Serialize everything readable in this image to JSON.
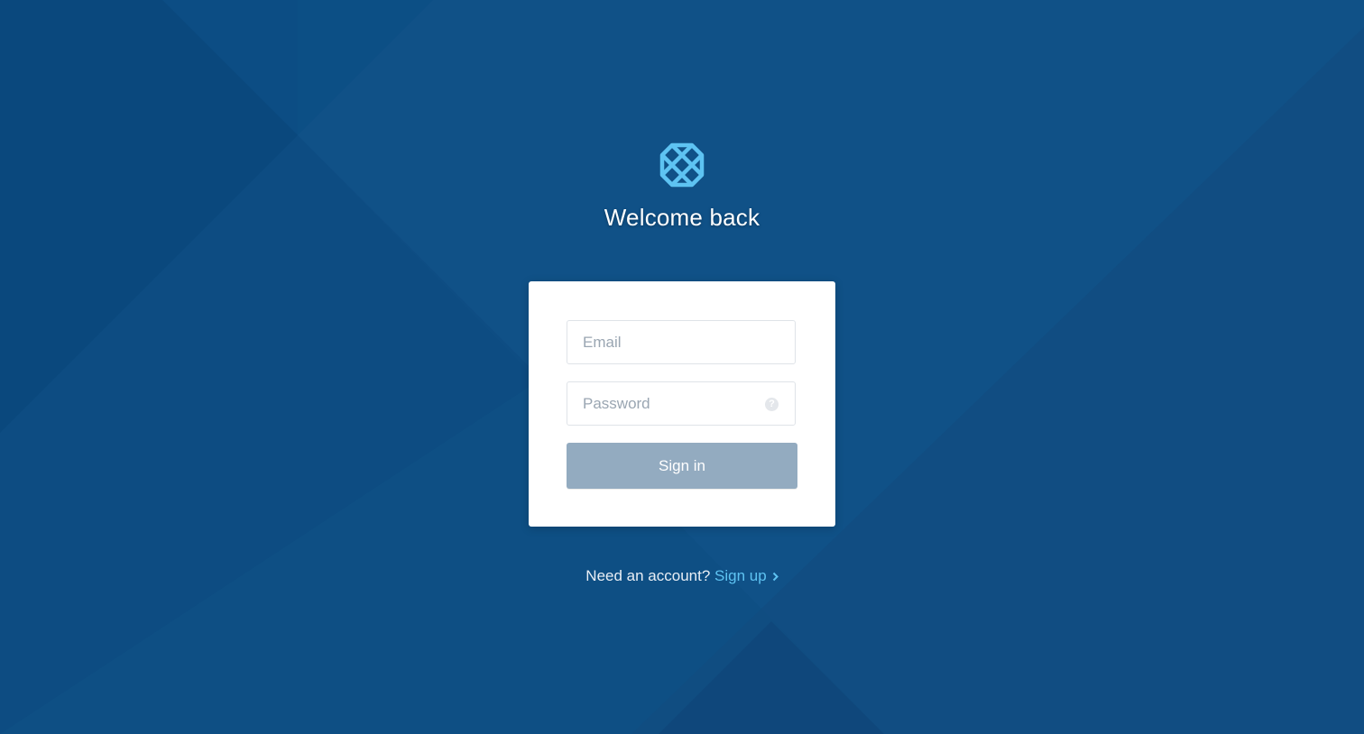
{
  "page": {
    "title": "Welcome back"
  },
  "colors": {
    "background": "#0e4f84",
    "logo": "#5ec3f2",
    "card": "#ffffff",
    "signin_button": "#93abc0",
    "link": "#5ec3f2"
  },
  "icons": {
    "logo": "lattice-logo-icon",
    "password_help": "question-circle-icon",
    "signup_arrow": "chevron-right-icon"
  },
  "form": {
    "email": {
      "placeholder": "Email",
      "value": ""
    },
    "password": {
      "placeholder": "Password",
      "value": "",
      "help_glyph": "?"
    },
    "submit_label": "Sign in"
  },
  "footer": {
    "prompt": "Need an account?",
    "link_label": "Sign up"
  }
}
